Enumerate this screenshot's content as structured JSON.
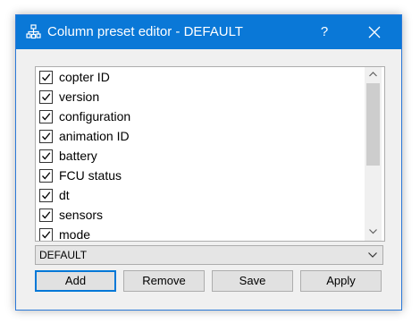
{
  "window": {
    "title": "Column preset editor - DEFAULT",
    "help_label": "?",
    "title_color": "#0a78d7"
  },
  "columns": {
    "items": [
      {
        "label": "copter ID",
        "checked": true
      },
      {
        "label": "version",
        "checked": true
      },
      {
        "label": "configuration",
        "checked": true
      },
      {
        "label": "animation ID",
        "checked": true
      },
      {
        "label": "battery",
        "checked": true
      },
      {
        "label": "FCU status",
        "checked": true
      },
      {
        "label": "dt",
        "checked": true
      },
      {
        "label": "sensors",
        "checked": true
      },
      {
        "label": "mode",
        "checked": true
      }
    ]
  },
  "preset": {
    "selected": "DEFAULT"
  },
  "buttons": {
    "add": "Add",
    "remove": "Remove",
    "save": "Save",
    "apply": "Apply"
  },
  "icons": {
    "app": "network-nodes-icon",
    "help": "help-icon",
    "close": "close-icon",
    "check": "checkmark-icon",
    "scroll_up": "chevron-up-icon",
    "scroll_down": "chevron-down-icon",
    "dropdown": "chevron-down-icon"
  }
}
